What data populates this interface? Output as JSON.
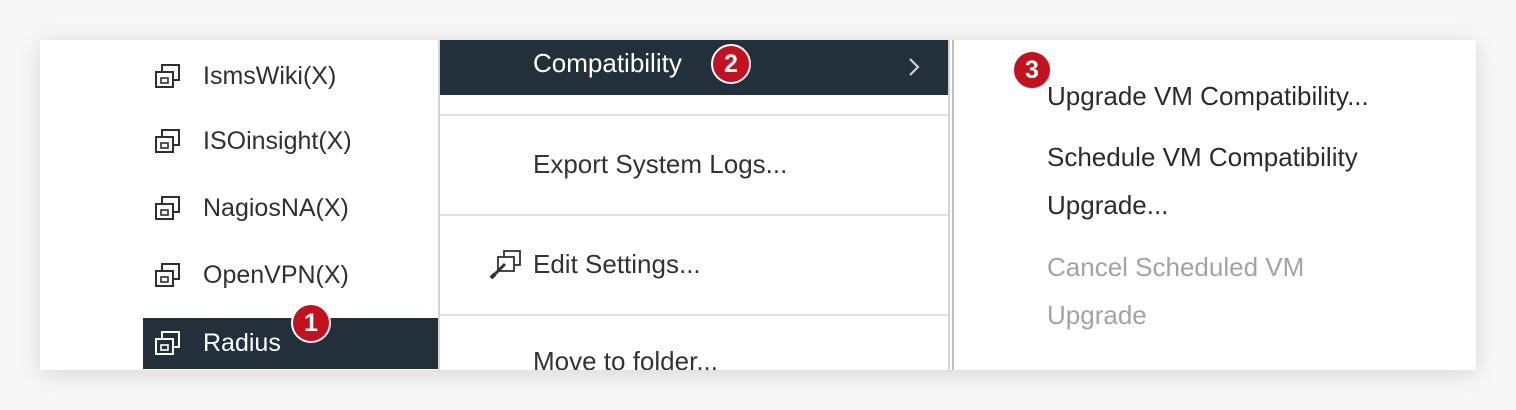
{
  "tree": {
    "items": [
      {
        "label": "IsmsWiki(X)",
        "icon": "vm-icon"
      },
      {
        "label": "ISOinsight(X)",
        "icon": "vm-icon"
      },
      {
        "label": "NagiosNA(X)",
        "icon": "vm-icon"
      },
      {
        "label": "OpenVPN(X)",
        "icon": "vm-icon"
      },
      {
        "label": "Radius",
        "icon": "vm-icon",
        "selected": true
      }
    ]
  },
  "context_menu": {
    "compatibility": "Compatibility",
    "export_logs": "Export System Logs...",
    "edit_settings": "Edit Settings...",
    "move_to_folder": "Move to folder..."
  },
  "submenu": {
    "upgrade": "Upgrade VM Compatibility...",
    "schedule_line1": "Schedule VM Compatibility",
    "schedule_line2": "Upgrade...",
    "cancel_line1": "Cancel Scheduled VM",
    "cancel_line2": "Upgrade"
  },
  "badges": {
    "step1": "1",
    "step2": "2",
    "step3": "3"
  },
  "colors": {
    "selected_bg": "#22303c",
    "badge": "#c4111e",
    "disabled_text": "#a3a3a3"
  }
}
